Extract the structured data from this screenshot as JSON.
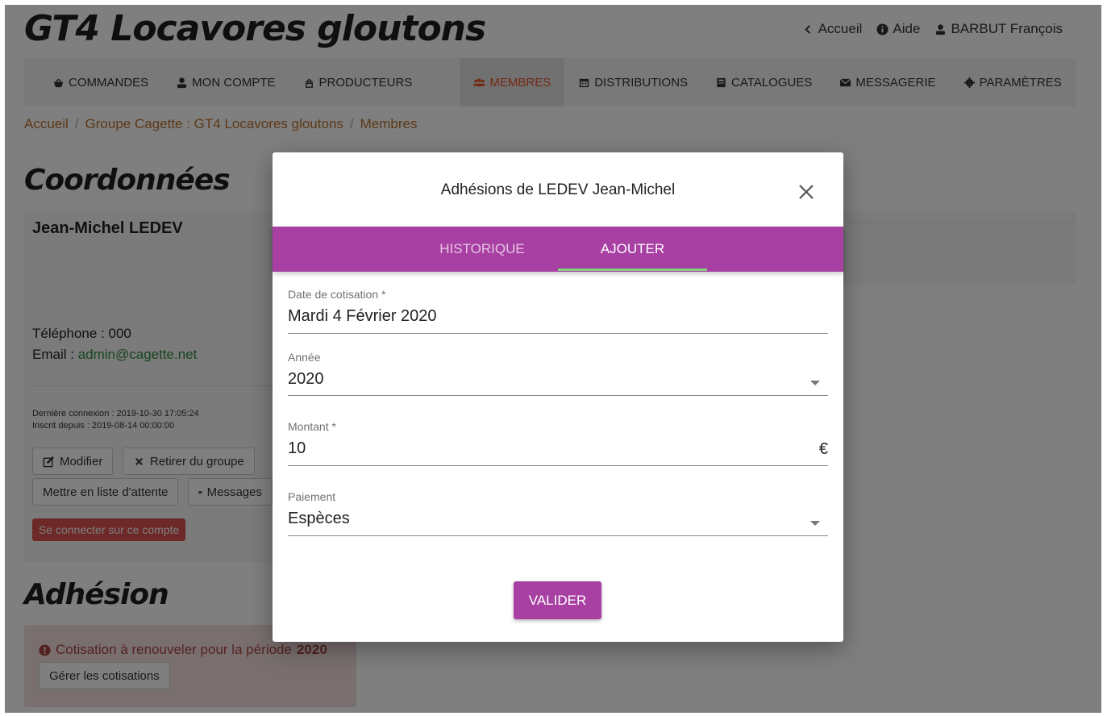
{
  "site": {
    "title": "GT4 Locavores gloutons",
    "top_links": {
      "home": "Accueil",
      "help": "Aide",
      "user": "BARBUT François"
    }
  },
  "nav": {
    "items": [
      {
        "label": "COMMANDES",
        "icon": "basket-icon"
      },
      {
        "label": "MON COMPTE",
        "icon": "user-icon"
      },
      {
        "label": "PRODUCTEURS",
        "icon": "farmer-icon"
      },
      {
        "label": "MEMBRES",
        "icon": "users-icon",
        "active": true
      },
      {
        "label": "DISTRIBUTIONS",
        "icon": "calendar-icon"
      },
      {
        "label": "CATALOGUES",
        "icon": "book-icon"
      },
      {
        "label": "MESSAGERIE",
        "icon": "envelope-icon"
      },
      {
        "label": "PARAMÈTRES",
        "icon": "gear-icon"
      }
    ]
  },
  "breadcrumb": [
    "Accueil",
    "Groupe Cagette : GT4 Locavores gloutons",
    "Membres"
  ],
  "member": {
    "section_title": "Coordonnées",
    "name": "Jean-Michel LEDEV",
    "phone_label": "Téléphone : ",
    "phone": "000",
    "email_label": "Email : ",
    "email": "admin@cagette.net",
    "last_login": "Dernière connexion : 2019-10-30 17:05:24",
    "registered": "Inscrit depuis : 2019-08-14 00:00:00",
    "btn_edit": "Modifier",
    "btn_remove": "Retirer du groupe",
    "btn_waitlist": "Mettre en liste d'attente",
    "btn_messages": "Messages",
    "btn_login_as": "Se connecter sur ce compte"
  },
  "membership": {
    "section_title": "Adhésion",
    "alert_prefix": "Cotisation à renouveler pour la période",
    "alert_year": "2020",
    "btn_manage": "Gérer les cotisations"
  },
  "modal": {
    "title": "Adhésions de LEDEV Jean-Michel",
    "tabs": [
      "HISTORIQUE",
      "AJOUTER"
    ],
    "active_tab": "AJOUTER",
    "fields": {
      "date": {
        "label": "Date de cotisation *",
        "value": "Mardi 4 Février 2020"
      },
      "year": {
        "label": "Année",
        "value": "2020"
      },
      "amount": {
        "label": "Montant *",
        "value": "10",
        "suffix": "€"
      },
      "payment": {
        "label": "Paiement",
        "value": "Espèces"
      }
    },
    "submit": "VALIDER"
  },
  "colors": {
    "primary_purple": "#a83fa3",
    "tab_indicator": "#7fd17a",
    "active_nav": "#e8532b",
    "link": "#b9722f",
    "danger": "#d9534f"
  }
}
